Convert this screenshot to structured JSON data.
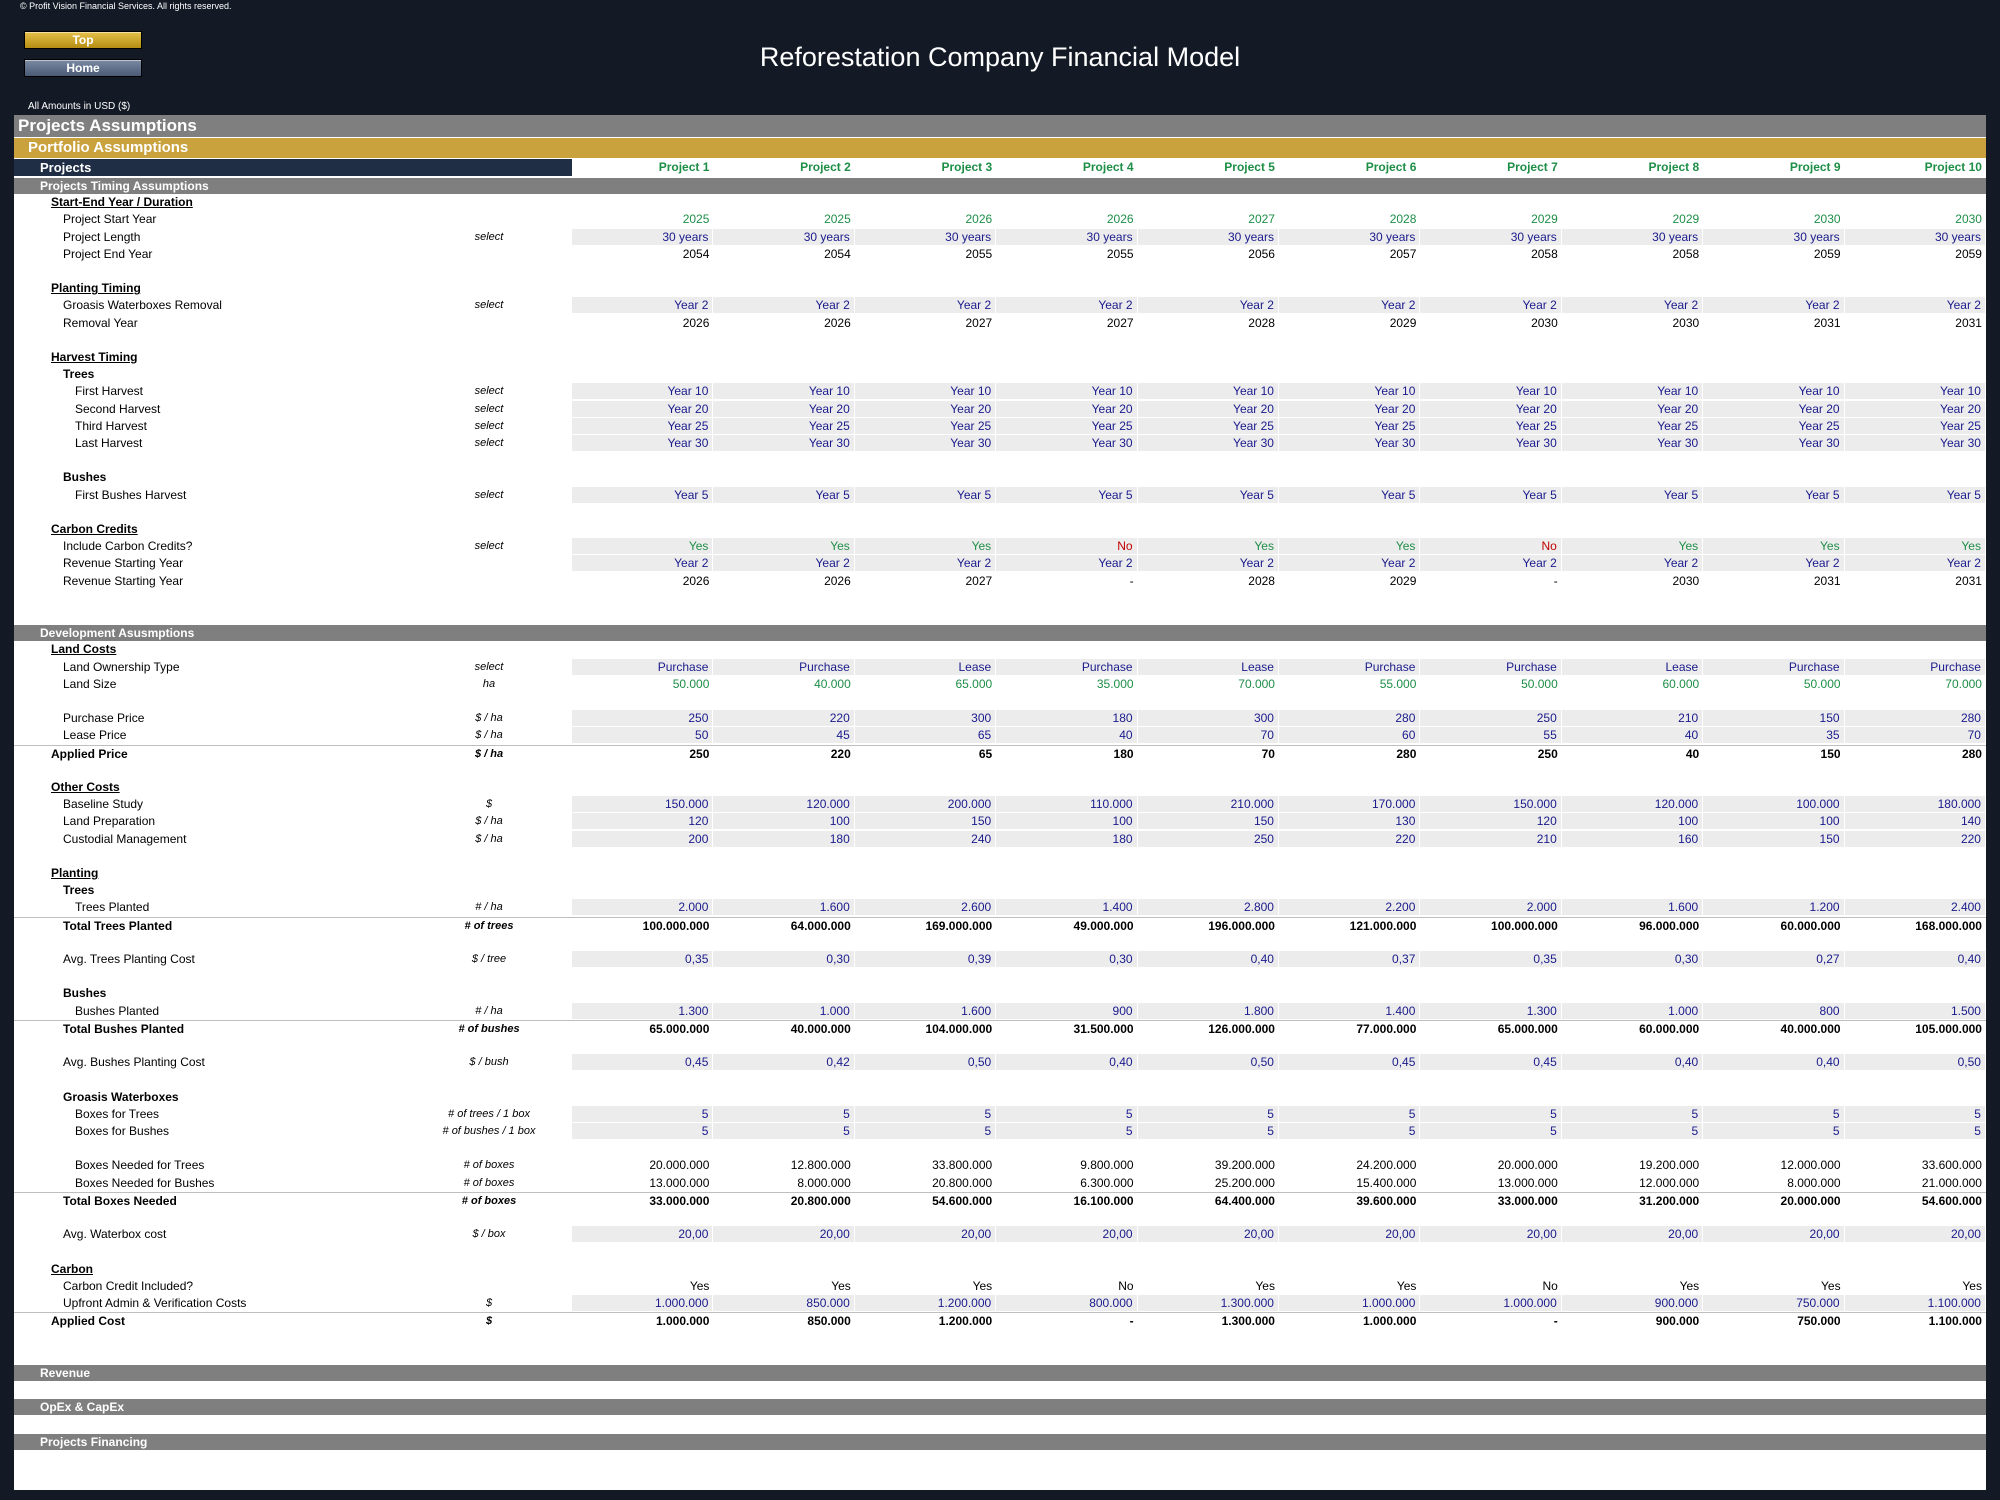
{
  "copyright": "© Profit Vision Financial Services. All rights reserved.",
  "nav": {
    "top": "Top",
    "home": "Home"
  },
  "title": "Reforestation Company Financial Model",
  "amounts_note": "All Amounts in  USD ($)",
  "headers": {
    "main": "Projects Assumptions",
    "portfolio": "Portfolio Assumptions",
    "projects_label": "Projects",
    "projects": [
      "Project 1",
      "Project 2",
      "Project 3",
      "Project 4",
      "Project 5",
      "Project 6",
      "Project 7",
      "Project 8",
      "Project 9",
      "Project 10"
    ]
  },
  "sections": [
    {
      "type": "sechdr",
      "label": "Projects Timing Assumptions"
    },
    {
      "type": "sub",
      "label": "Start-End Year / Duration"
    },
    {
      "type": "data",
      "label": "Project Start Year",
      "style": "green",
      "values": [
        "2025",
        "2025",
        "2026",
        "2026",
        "2027",
        "2028",
        "2029",
        "2029",
        "2030",
        "2030"
      ]
    },
    {
      "type": "data",
      "label": "Project Length",
      "unit": "select",
      "style": "input",
      "values": [
        "30 years",
        "30 years",
        "30 years",
        "30 years",
        "30 years",
        "30 years",
        "30 years",
        "30 years",
        "30 years",
        "30 years"
      ]
    },
    {
      "type": "data",
      "label": "Project End Year",
      "values": [
        "2054",
        "2054",
        "2055",
        "2055",
        "2056",
        "2057",
        "2058",
        "2058",
        "2059",
        "2059"
      ]
    },
    {
      "type": "blank"
    },
    {
      "type": "sub",
      "label": "Planting Timing"
    },
    {
      "type": "data",
      "label": "Groasis Waterboxes Removal",
      "unit": "select",
      "style": "input",
      "values": [
        "Year 2",
        "Year 2",
        "Year 2",
        "Year 2",
        "Year 2",
        "Year 2",
        "Year 2",
        "Year 2",
        "Year 2",
        "Year 2"
      ]
    },
    {
      "type": "data",
      "label": "Removal Year",
      "values": [
        "2026",
        "2026",
        "2027",
        "2027",
        "2028",
        "2029",
        "2030",
        "2030",
        "2031",
        "2031"
      ]
    },
    {
      "type": "blank"
    },
    {
      "type": "sub",
      "label": "Harvest Timing"
    },
    {
      "type": "grp",
      "label": "Trees"
    },
    {
      "type": "data",
      "indent": 2,
      "label": "First Harvest",
      "unit": "select",
      "style": "input",
      "values": [
        "Year 10",
        "Year 10",
        "Year 10",
        "Year 10",
        "Year 10",
        "Year 10",
        "Year 10",
        "Year 10",
        "Year 10",
        "Year 10"
      ]
    },
    {
      "type": "data",
      "indent": 2,
      "label": "Second Harvest",
      "unit": "select",
      "style": "input",
      "values": [
        "Year 20",
        "Year 20",
        "Year 20",
        "Year 20",
        "Year 20",
        "Year 20",
        "Year 20",
        "Year 20",
        "Year 20",
        "Year 20"
      ]
    },
    {
      "type": "data",
      "indent": 2,
      "label": "Third Harvest",
      "unit": "select",
      "style": "input",
      "values": [
        "Year 25",
        "Year 25",
        "Year 25",
        "Year 25",
        "Year 25",
        "Year 25",
        "Year 25",
        "Year 25",
        "Year 25",
        "Year 25"
      ]
    },
    {
      "type": "data",
      "indent": 2,
      "label": "Last Harvest",
      "unit": "select",
      "style": "input",
      "values": [
        "Year 30",
        "Year 30",
        "Year 30",
        "Year 30",
        "Year 30",
        "Year 30",
        "Year 30",
        "Year 30",
        "Year 30",
        "Year 30"
      ]
    },
    {
      "type": "blank"
    },
    {
      "type": "grp",
      "label": "Bushes"
    },
    {
      "type": "data",
      "indent": 2,
      "label": "First Bushes Harvest",
      "unit": "select",
      "style": "input",
      "values": [
        "Year 5",
        "Year 5",
        "Year 5",
        "Year 5",
        "Year 5",
        "Year 5",
        "Year 5",
        "Year 5",
        "Year 5",
        "Year 5"
      ]
    },
    {
      "type": "blank"
    },
    {
      "type": "sub",
      "label": "Carbon Credits"
    },
    {
      "type": "data",
      "label": "Include Carbon Credits?",
      "unit": "select",
      "style": "input",
      "values": [
        "Yes",
        "Yes",
        "Yes",
        "No",
        "Yes",
        "Yes",
        "No",
        "Yes",
        "Yes",
        "Yes"
      ],
      "colors": [
        "green",
        "green",
        "green",
        "red",
        "green",
        "green",
        "red",
        "green",
        "green",
        "green"
      ]
    },
    {
      "type": "data",
      "label": "Revenue Starting Year",
      "style": "input",
      "values": [
        "Year 2",
        "Year 2",
        "Year 2",
        "Year 2",
        "Year 2",
        "Year 2",
        "Year 2",
        "Year 2",
        "Year 2",
        "Year 2"
      ]
    },
    {
      "type": "data",
      "label": "Revenue Starting Year",
      "values": [
        "2026",
        "2026",
        "2027",
        "-",
        "2028",
        "2029",
        "-",
        "2030",
        "2031",
        "2031"
      ]
    },
    {
      "type": "blank"
    },
    {
      "type": "blank"
    },
    {
      "type": "sechdr",
      "label": "Development Asusmptions"
    },
    {
      "type": "sub",
      "label": "Land Costs"
    },
    {
      "type": "data",
      "label": "Land Ownership Type",
      "unit": "select",
      "style": "input",
      "values": [
        "Purchase",
        "Purchase",
        "Lease",
        "Purchase",
        "Lease",
        "Purchase",
        "Purchase",
        "Lease",
        "Purchase",
        "Purchase"
      ]
    },
    {
      "type": "data",
      "label": "Land Size",
      "unit": "ha",
      "style": "green",
      "values": [
        "50.000",
        "40.000",
        "65.000",
        "35.000",
        "70.000",
        "55.000",
        "50.000",
        "60.000",
        "50.000",
        "70.000"
      ]
    },
    {
      "type": "blank"
    },
    {
      "type": "data",
      "label": "Purchase Price",
      "unit": "$ / ha",
      "style": "input",
      "values": [
        "250",
        "220",
        "300",
        "180",
        "300",
        "280",
        "250",
        "210",
        "150",
        "280"
      ]
    },
    {
      "type": "data",
      "label": "Lease Price",
      "unit": "$ / ha",
      "style": "input",
      "values": [
        "50",
        "45",
        "65",
        "40",
        "70",
        "60",
        "55",
        "40",
        "35",
        "70"
      ]
    },
    {
      "type": "data",
      "indent": 0,
      "label": "Applied Price",
      "unit": "$ / ha",
      "style": "bold",
      "topline": true,
      "values": [
        "250",
        "220",
        "65",
        "180",
        "70",
        "280",
        "250",
        "40",
        "150",
        "280"
      ]
    },
    {
      "type": "blank"
    },
    {
      "type": "sub",
      "label": "Other Costs"
    },
    {
      "type": "data",
      "label": "Baseline Study",
      "unit": "$",
      "style": "input",
      "values": [
        "150.000",
        "120.000",
        "200.000",
        "110.000",
        "210.000",
        "170.000",
        "150.000",
        "120.000",
        "100.000",
        "180.000"
      ]
    },
    {
      "type": "data",
      "label": "Land Preparation",
      "unit": "$ / ha",
      "style": "input",
      "values": [
        "120",
        "100",
        "150",
        "100",
        "150",
        "130",
        "120",
        "100",
        "100",
        "140"
      ]
    },
    {
      "type": "data",
      "label": "Custodial Management",
      "unit": "$ / ha",
      "style": "input",
      "values": [
        "200",
        "180",
        "240",
        "180",
        "250",
        "220",
        "210",
        "160",
        "150",
        "220"
      ]
    },
    {
      "type": "blank"
    },
    {
      "type": "sub",
      "label": "Planting"
    },
    {
      "type": "grp",
      "label": "Trees"
    },
    {
      "type": "data",
      "indent": 2,
      "label": "Trees Planted",
      "unit": "# / ha",
      "style": "input",
      "values": [
        "2.000",
        "1.600",
        "2.600",
        "1.400",
        "2.800",
        "2.200",
        "2.000",
        "1.600",
        "1.200",
        "2.400"
      ]
    },
    {
      "type": "data",
      "label": "Total Trees Planted",
      "unit": "# of trees",
      "style": "bold",
      "topline": true,
      "values": [
        "100.000.000",
        "64.000.000",
        "169.000.000",
        "49.000.000",
        "196.000.000",
        "121.000.000",
        "100.000.000",
        "96.000.000",
        "60.000.000",
        "168.000.000"
      ]
    },
    {
      "type": "blank"
    },
    {
      "type": "data",
      "label": "Avg. Trees Planting Cost",
      "unit": "$ / tree",
      "style": "input",
      "values": [
        "0,35",
        "0,30",
        "0,39",
        "0,30",
        "0,40",
        "0,37",
        "0,35",
        "0,30",
        "0,27",
        "0,40"
      ]
    },
    {
      "type": "blank"
    },
    {
      "type": "grp",
      "label": "Bushes"
    },
    {
      "type": "data",
      "indent": 2,
      "label": "Bushes Planted",
      "unit": "# / ha",
      "style": "input",
      "values": [
        "1.300",
        "1.000",
        "1.600",
        "900",
        "1.800",
        "1.400",
        "1.300",
        "1.000",
        "800",
        "1.500"
      ]
    },
    {
      "type": "data",
      "label": "Total Bushes Planted",
      "unit": "# of bushes",
      "style": "bold",
      "topline": true,
      "values": [
        "65.000.000",
        "40.000.000",
        "104.000.000",
        "31.500.000",
        "126.000.000",
        "77.000.000",
        "65.000.000",
        "60.000.000",
        "40.000.000",
        "105.000.000"
      ]
    },
    {
      "type": "blank"
    },
    {
      "type": "data",
      "label": "Avg. Bushes Planting Cost",
      "unit": "$ / bush",
      "style": "input",
      "values": [
        "0,45",
        "0,42",
        "0,50",
        "0,40",
        "0,50",
        "0,45",
        "0,45",
        "0,40",
        "0,40",
        "0,50"
      ]
    },
    {
      "type": "blank"
    },
    {
      "type": "grp",
      "label": "Groasis Waterboxes"
    },
    {
      "type": "data",
      "indent": 2,
      "label": "Boxes for Trees",
      "unit": "# of trees / 1 box",
      "style": "input",
      "values": [
        "5",
        "5",
        "5",
        "5",
        "5",
        "5",
        "5",
        "5",
        "5",
        "5"
      ]
    },
    {
      "type": "data",
      "indent": 2,
      "label": "Boxes for Bushes",
      "unit": "# of bushes / 1 box",
      "style": "input",
      "values": [
        "5",
        "5",
        "5",
        "5",
        "5",
        "5",
        "5",
        "5",
        "5",
        "5"
      ]
    },
    {
      "type": "blank"
    },
    {
      "type": "data",
      "indent": 2,
      "label": "Boxes Needed for Trees",
      "unit": "# of boxes",
      "values": [
        "20.000.000",
        "12.800.000",
        "33.800.000",
        "9.800.000",
        "39.200.000",
        "24.200.000",
        "20.000.000",
        "19.200.000",
        "12.000.000",
        "33.600.000"
      ]
    },
    {
      "type": "data",
      "indent": 2,
      "label": "Boxes Needed for Bushes",
      "unit": "# of boxes",
      "values": [
        "13.000.000",
        "8.000.000",
        "20.800.000",
        "6.300.000",
        "25.200.000",
        "15.400.000",
        "13.000.000",
        "12.000.000",
        "8.000.000",
        "21.000.000"
      ]
    },
    {
      "type": "data",
      "label": "Total Boxes Needed",
      "unit": "# of boxes",
      "style": "bold",
      "topline": true,
      "values": [
        "33.000.000",
        "20.800.000",
        "54.600.000",
        "16.100.000",
        "64.400.000",
        "39.600.000",
        "33.000.000",
        "31.200.000",
        "20.000.000",
        "54.600.000"
      ]
    },
    {
      "type": "blank"
    },
    {
      "type": "data",
      "label": "Avg. Waterbox cost",
      "unit": "$ / box",
      "style": "input",
      "values": [
        "20,00",
        "20,00",
        "20,00",
        "20,00",
        "20,00",
        "20,00",
        "20,00",
        "20,00",
        "20,00",
        "20,00"
      ]
    },
    {
      "type": "blank"
    },
    {
      "type": "sub",
      "label": "Carbon "
    },
    {
      "type": "data",
      "label": "Carbon Credit Included?",
      "values": [
        "Yes",
        "Yes",
        "Yes",
        "No",
        "Yes",
        "Yes",
        "No",
        "Yes",
        "Yes",
        "Yes"
      ]
    },
    {
      "type": "data",
      "label": "Upfront Admin & Verification Costs",
      "unit": "$",
      "style": "input",
      "values": [
        "1.000.000",
        "850.000",
        "1.200.000",
        "800.000",
        "1.300.000",
        "1.000.000",
        "1.000.000",
        "900.000",
        "750.000",
        "1.100.000"
      ]
    },
    {
      "type": "data",
      "indent": 0,
      "label": "Applied Cost",
      "unit": "$",
      "style": "bold",
      "topline": true,
      "values": [
        "1.000.000",
        "850.000",
        "1.200.000",
        "-",
        "1.300.000",
        "1.000.000",
        "-",
        "900.000",
        "750.000",
        "1.100.000"
      ]
    },
    {
      "type": "blank"
    },
    {
      "type": "blank"
    },
    {
      "type": "sechdr",
      "label": "Revenue"
    },
    {
      "type": "blank"
    },
    {
      "type": "sechdr",
      "label": "OpEx & CapEx"
    },
    {
      "type": "blank"
    },
    {
      "type": "sechdr",
      "label": "Projects Financing"
    }
  ]
}
